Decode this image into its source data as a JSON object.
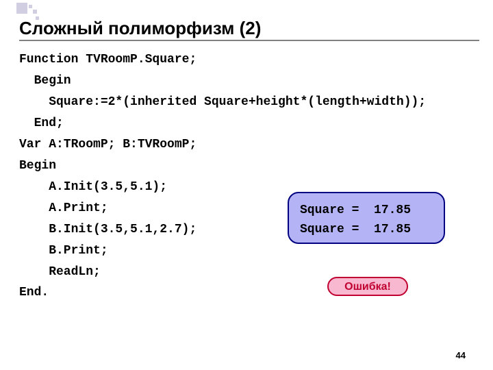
{
  "title": "Сложный полиморфизм (2)",
  "code": {
    "l1": "Function TVRoomP.Square;",
    "l2": "  Begin",
    "l3": "    Square:=2*(inherited Square+height*(length+width));",
    "l4": "  End;",
    "l5": "Var A:TRoomP; B:TVRoomP;",
    "l6": "Begin",
    "l7": "    A.Init(3.5,5.1);",
    "l8": "    A.Print;",
    "l9": "    B.Init(3.5,5.1,2.7);",
    "l10": "    B.Print;",
    "l11": "    ReadLn;",
    "l12": "End."
  },
  "output": {
    "line1": "Square =  17.85",
    "line2": "Square =  17.85"
  },
  "error_label": "Ошибка!",
  "page_number": "44"
}
